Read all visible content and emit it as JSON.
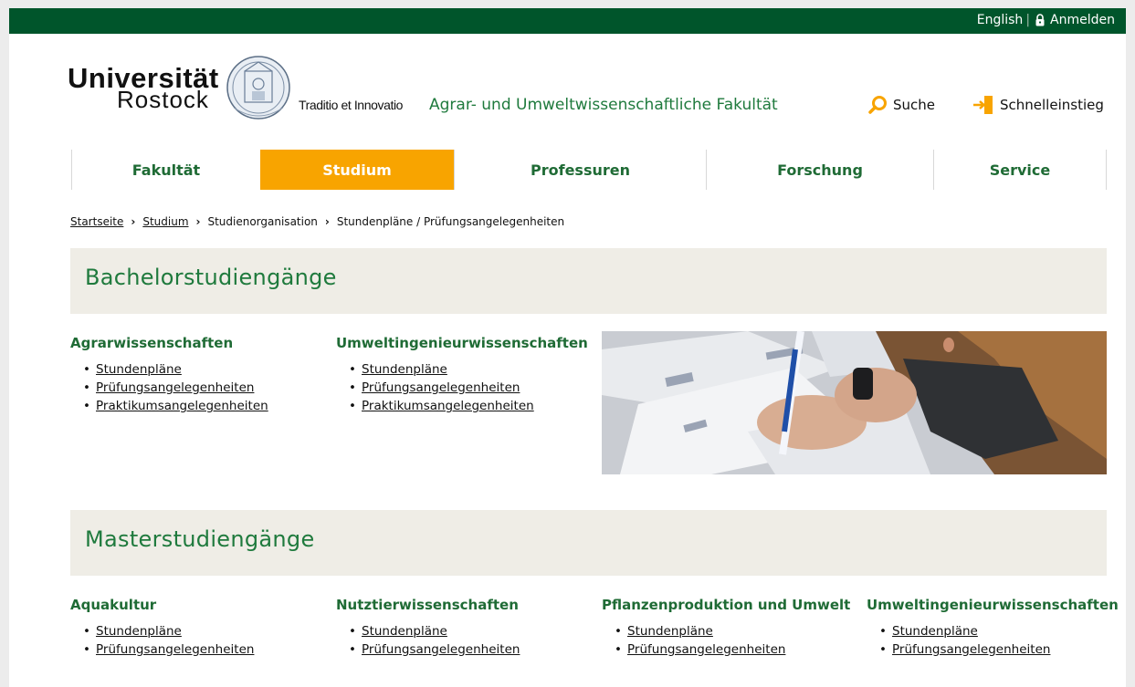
{
  "topbar": {
    "lang": "English",
    "separator": "|",
    "login": "Anmelden"
  },
  "header": {
    "logo_line1": "Universität",
    "logo_line2": "Rostock",
    "tagline": "Traditio et Innovatio",
    "faculty": "Agrar- und Umweltwissenschaftliche Fakultät",
    "search_label": "Suche",
    "quick_label": "Schnelleinstieg",
    "accent": "#f8a400",
    "brand_green": "#00552b"
  },
  "nav": {
    "items": [
      {
        "label": "Fakultät",
        "active": false
      },
      {
        "label": "Studium",
        "active": true
      },
      {
        "label": "Professuren",
        "active": false
      },
      {
        "label": "Forschung",
        "active": false
      },
      {
        "label": "Service",
        "active": false
      }
    ]
  },
  "breadcrumb": [
    "Startseite",
    "Studium",
    "Studienorganisation",
    "Stundenpläne / Prüfungsangelegenheiten"
  ],
  "bachelor": {
    "title": "Bachelorstudiengänge",
    "programs": [
      {
        "name": "Agrarwissenschaften",
        "links": [
          "Stundenpläne",
          "Prüfungsangelegenheiten",
          "Praktikumsangelegenheiten"
        ]
      },
      {
        "name": "Umweltingenieurwissenschaften",
        "links": [
          "Stundenpläne",
          "Prüfungsangelegenheiten",
          "Praktikumsangelegenheiten"
        ]
      }
    ]
  },
  "master": {
    "title": "Masterstudiengänge",
    "programs": [
      {
        "name": "Aquakultur",
        "links": [
          "Stundenpläne",
          "Prüfungsangelegenheiten"
        ]
      },
      {
        "name": "Nutztierwissenschaften",
        "links": [
          "Stundenpläne",
          "Prüfungsangelegenheiten"
        ]
      },
      {
        "name": "Pflanzenproduktion und Umwelt",
        "links": [
          "Stundenpläne",
          "Prüfungsangelegenheiten"
        ]
      },
      {
        "name": "Umweltingenieurwissenschaften",
        "links": [
          "Stundenpläne",
          "Prüfungsangelegenheiten"
        ]
      }
    ]
  }
}
